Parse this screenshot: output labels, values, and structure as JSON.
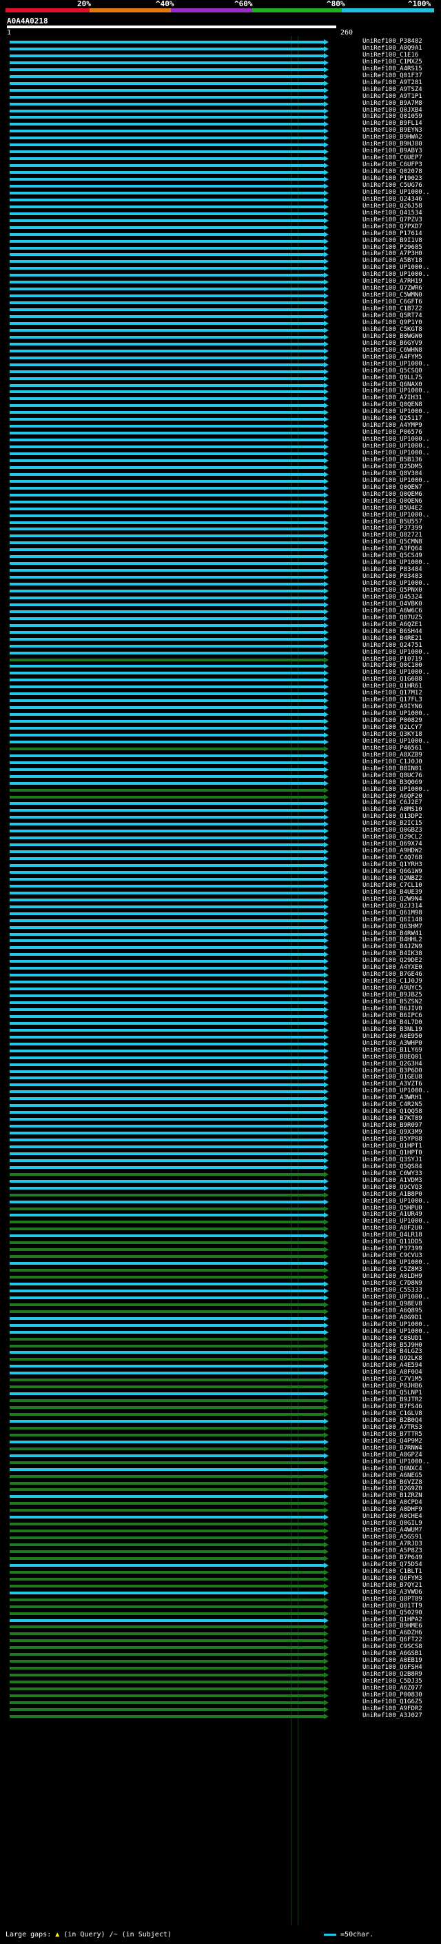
{
  "legend": {
    "ticks": [
      "20%",
      "^40%",
      "^60%",
      "^80%",
      "^100%"
    ],
    "colors": [
      "#e0102a",
      "#e07a10",
      "#9a2cc8",
      "#22b022",
      "#22c0e0"
    ]
  },
  "query": {
    "name": "A0A4A0218",
    "start_label": "1",
    "end_label": "260"
  },
  "footer": {
    "large_gaps_label": "Large gaps:",
    "gap_in_query": "(in Query)",
    "gap_in_subject": "/~ (in Subject)",
    "scale_label": "=50char."
  },
  "colors": {
    "cyan": "#22c8e8",
    "green": "#1e7a1e",
    "bright_green": "#3cd23c",
    "grey": "#7a8a8a"
  },
  "hits": [
    {
      "label": "UniRef100_P38482",
      "color": "cyan"
    },
    {
      "label": "UniRef100_A0Q9A1",
      "color": "cyan"
    },
    {
      "label": "UniRef100_C1E16",
      "color": "cyan"
    },
    {
      "label": "UniRef100_C1MXZ5",
      "color": "cyan"
    },
    {
      "label": "UniRef100_A4RS15",
      "color": "cyan"
    },
    {
      "label": "UniRef100_Q01F37",
      "color": "cyan"
    },
    {
      "label": "UniRef100_A9T281",
      "color": "cyan"
    },
    {
      "label": "UniRef100_A9TSZ4",
      "color": "cyan"
    },
    {
      "label": "UniRef100_A9T1P1",
      "color": "cyan"
    },
    {
      "label": "UniRef100_B9A7M8",
      "color": "cyan"
    },
    {
      "label": "UniRef100_Q0JXB4",
      "color": "cyan"
    },
    {
      "label": "UniRef100_Q01059",
      "color": "cyan"
    },
    {
      "label": "UniRef100_B9FL14",
      "color": "cyan"
    },
    {
      "label": "UniRef100_B9EYN3",
      "color": "cyan"
    },
    {
      "label": "UniRef100_B9HWA2",
      "color": "cyan"
    },
    {
      "label": "UniRef100_B9HJ80",
      "color": "cyan"
    },
    {
      "label": "UniRef100_B9ABY3",
      "color": "cyan"
    },
    {
      "label": "UniRef100_C6UEP7",
      "color": "cyan"
    },
    {
      "label": "UniRef100_C6UFP3",
      "color": "cyan"
    },
    {
      "label": "UniRef100_Q02078",
      "color": "cyan"
    },
    {
      "label": "UniRef100_P19023",
      "color": "cyan"
    },
    {
      "label": "UniRef100_C5UG76",
      "color": "cyan"
    },
    {
      "label": "UniRef100_UP1000..",
      "color": "cyan"
    },
    {
      "label": "UniRef100_Q24346",
      "color": "cyan"
    },
    {
      "label": "UniRef100_Q26J58",
      "color": "cyan"
    },
    {
      "label": "UniRef100_Q41534",
      "color": "cyan"
    },
    {
      "label": "UniRef100_Q7PZV3",
      "color": "cyan"
    },
    {
      "label": "UniRef100_Q7PXD7",
      "color": "cyan"
    },
    {
      "label": "UniRef100_P17614",
      "color": "cyan"
    },
    {
      "label": "UniRef100_B9I1V8",
      "color": "cyan"
    },
    {
      "label": "UniRef100_P29685",
      "color": "cyan"
    },
    {
      "label": "UniRef100_A7P3H0",
      "color": "cyan"
    },
    {
      "label": "UniRef100_A5BY18",
      "color": "cyan"
    },
    {
      "label": "UniRef100_UP1000..",
      "color": "cyan"
    },
    {
      "label": "UniRef100_UP1000..",
      "color": "cyan"
    },
    {
      "label": "UniRef100_A7RH19",
      "color": "cyan"
    },
    {
      "label": "UniRef100_Q7ZWR6",
      "color": "cyan"
    },
    {
      "label": "UniRef100_C5WMN0",
      "color": "cyan"
    },
    {
      "label": "UniRef100_C6GFT6",
      "color": "cyan"
    },
    {
      "label": "UniRef100_C1B7Z2",
      "color": "cyan"
    },
    {
      "label": "UniRef100_Q5RT74",
      "color": "cyan"
    },
    {
      "label": "UniRef100_Q9P1Y0",
      "color": "cyan"
    },
    {
      "label": "UniRef100_C5KGT8",
      "color": "cyan"
    },
    {
      "label": "UniRef100_B0WGW0",
      "color": "cyan"
    },
    {
      "label": "UniRef100_B6GYV9",
      "color": "cyan"
    },
    {
      "label": "UniRef100_C6WHN8",
      "color": "cyan"
    },
    {
      "label": "UniRef100_A4FYM5",
      "color": "cyan"
    },
    {
      "label": "UniRef100_UP1000..",
      "color": "cyan"
    },
    {
      "label": "UniRef100_Q5CSQ0",
      "color": "cyan"
    },
    {
      "label": "UniRef100_Q9LL75",
      "color": "cyan"
    },
    {
      "label": "UniRef100_Q6NAX0",
      "color": "cyan"
    },
    {
      "label": "UniRef100_UP1000..",
      "color": "cyan"
    },
    {
      "label": "UniRef100_A7IH31",
      "color": "cyan"
    },
    {
      "label": "UniRef100_Q0QEN8",
      "color": "cyan"
    },
    {
      "label": "UniRef100_UP1000..",
      "color": "cyan"
    },
    {
      "label": "UniRef100_Q25117",
      "color": "cyan"
    },
    {
      "label": "UniRef100_A4YMP9",
      "color": "cyan"
    },
    {
      "label": "UniRef100_P06576",
      "color": "cyan"
    },
    {
      "label": "UniRef100_UP1000..",
      "color": "cyan"
    },
    {
      "label": "UniRef100_UP1000..",
      "color": "cyan"
    },
    {
      "label": "UniRef100_UP1000..",
      "color": "cyan"
    },
    {
      "label": "UniRef100_B5B136",
      "color": "cyan"
    },
    {
      "label": "UniRef100_Q25DM5",
      "color": "cyan"
    },
    {
      "label": "UniRef100_Q8V304",
      "color": "cyan"
    },
    {
      "label": "UniRef100_UP1000..",
      "color": "cyan"
    },
    {
      "label": "UniRef100_Q0QEN7",
      "color": "cyan"
    },
    {
      "label": "UniRef100_Q0QEM6",
      "color": "cyan"
    },
    {
      "label": "UniRef100_Q0QEN6",
      "color": "cyan"
    },
    {
      "label": "UniRef100_B5U4E2",
      "color": "cyan"
    },
    {
      "label": "UniRef100_UP1000..",
      "color": "cyan"
    },
    {
      "label": "UniRef100_B5U557",
      "color": "cyan"
    },
    {
      "label": "UniRef100_P37399",
      "color": "cyan"
    },
    {
      "label": "UniRef100_Q82721",
      "color": "cyan"
    },
    {
      "label": "UniRef100_Q5CMN8",
      "color": "cyan"
    },
    {
      "label": "UniRef100_A3FQ64",
      "color": "cyan"
    },
    {
      "label": "UniRef100_Q5CS49",
      "color": "cyan"
    },
    {
      "label": "UniRef100_UP1000..",
      "color": "cyan"
    },
    {
      "label": "UniRef100_P83484",
      "color": "cyan"
    },
    {
      "label": "UniRef100_P83483",
      "color": "cyan"
    },
    {
      "label": "UniRef100_UP1000..",
      "color": "cyan"
    },
    {
      "label": "UniRef100_Q5PNX0",
      "color": "cyan"
    },
    {
      "label": "UniRef100_Q45324",
      "color": "cyan"
    },
    {
      "label": "UniRef100_Q4VBK0",
      "color": "cyan"
    },
    {
      "label": "UniRef100_A6W6C6",
      "color": "cyan"
    },
    {
      "label": "UniRef100_Q07UZ5",
      "color": "cyan"
    },
    {
      "label": "UniRef100_A6QZE1",
      "color": "cyan"
    },
    {
      "label": "UniRef100_B6SH44",
      "color": "cyan"
    },
    {
      "label": "UniRef100_B4RE21",
      "color": "cyan"
    },
    {
      "label": "UniRef100_Q24751",
      "color": "cyan"
    },
    {
      "label": "UniRef100_UP1000..",
      "color": "cyan"
    },
    {
      "label": "UniRef100_P10719",
      "color": "green"
    },
    {
      "label": "UniRef100_Q0C100",
      "color": "cyan"
    },
    {
      "label": "UniRef100_UP1000..",
      "color": "cyan"
    },
    {
      "label": "UniRef100_Q1G6B8",
      "color": "cyan"
    },
    {
      "label": "UniRef100_Q1HR61",
      "color": "cyan"
    },
    {
      "label": "UniRef100_Q17M12",
      "color": "cyan"
    },
    {
      "label": "UniRef100_Q17FL3",
      "color": "cyan"
    },
    {
      "label": "UniRef100_A9IYN6",
      "color": "cyan"
    },
    {
      "label": "UniRef100_UP1000..",
      "color": "cyan"
    },
    {
      "label": "UniRef100_P00829",
      "color": "cyan"
    },
    {
      "label": "UniRef100_Q2LCY7",
      "color": "cyan"
    },
    {
      "label": "UniRef100_Q3KY18",
      "color": "cyan"
    },
    {
      "label": "UniRef100_UP1000..",
      "color": "cyan"
    },
    {
      "label": "UniRef100_P46561",
      "color": "green"
    },
    {
      "label": "UniRef100_A8XZB9",
      "color": "cyan"
    },
    {
      "label": "UniRef100_C1J0J0",
      "color": "cyan"
    },
    {
      "label": "UniRef100_B8IN01",
      "color": "cyan"
    },
    {
      "label": "UniRef100_Q8UC76",
      "color": "cyan"
    },
    {
      "label": "UniRef100_B3Q069",
      "color": "cyan"
    },
    {
      "label": "UniRef100_UP1000..",
      "color": "green"
    },
    {
      "label": "UniRef100_A6QF20",
      "color": "green"
    },
    {
      "label": "UniRef100_C6J2E7",
      "color": "cyan"
    },
    {
      "label": "UniRef100_A8MS10",
      "color": "cyan"
    },
    {
      "label": "UniRef100_Q13DP2",
      "color": "cyan"
    },
    {
      "label": "UniRef100_B2IC15",
      "color": "cyan"
    },
    {
      "label": "UniRef100_Q0GBZ3",
      "color": "cyan"
    },
    {
      "label": "UniRef100_Q29CL2",
      "color": "cyan"
    },
    {
      "label": "UniRef100_Q69X74",
      "color": "cyan"
    },
    {
      "label": "UniRef100_A9HDW2",
      "color": "cyan"
    },
    {
      "label": "UniRef100_C4Q768",
      "color": "cyan"
    },
    {
      "label": "UniRef100_Q1YRH3",
      "color": "cyan"
    },
    {
      "label": "UniRef100_Q6G1W9",
      "color": "cyan"
    },
    {
      "label": "UniRef100_Q2NBZ2",
      "color": "cyan"
    },
    {
      "label": "UniRef100_C7CL10",
      "color": "cyan"
    },
    {
      "label": "UniRef100_B4UE39",
      "color": "cyan"
    },
    {
      "label": "UniRef100_Q2W9N4",
      "color": "cyan"
    },
    {
      "label": "UniRef100_Q2J314",
      "color": "cyan"
    },
    {
      "label": "UniRef100_Q61M98",
      "color": "cyan"
    },
    {
      "label": "UniRef100_Q6I148",
      "color": "cyan"
    },
    {
      "label": "UniRef100_Q63HM7",
      "color": "cyan"
    },
    {
      "label": "UniRef100_B4RW41",
      "color": "cyan"
    },
    {
      "label": "UniRef100_B4HHL2",
      "color": "cyan"
    },
    {
      "label": "UniRef100_B4JZN9",
      "color": "cyan"
    },
    {
      "label": "UniRef100_B4IK38",
      "color": "cyan"
    },
    {
      "label": "UniRef100_Q29DE2",
      "color": "cyan"
    },
    {
      "label": "UniRef100_A4YXE0",
      "color": "cyan"
    },
    {
      "label": "UniRef100_B7GE46",
      "color": "cyan"
    },
    {
      "label": "UniRef100_C1J0J9",
      "color": "cyan"
    },
    {
      "label": "UniRef100_A9UYC5",
      "color": "cyan"
    },
    {
      "label": "UniRef100_B9JBZ5",
      "color": "cyan"
    },
    {
      "label": "UniRef100_B5ZSN2",
      "color": "cyan"
    },
    {
      "label": "UniRef100_B6JIV0",
      "color": "cyan"
    },
    {
      "label": "UniRef100_B6IPC6",
      "color": "cyan"
    },
    {
      "label": "UniRef100_B4L7D0",
      "color": "cyan"
    },
    {
      "label": "UniRef100_B3NL19",
      "color": "cyan"
    },
    {
      "label": "UniRef100_A0E950",
      "color": "cyan"
    },
    {
      "label": "UniRef100_A3WHP0",
      "color": "cyan"
    },
    {
      "label": "UniRef100_B1LY69",
      "color": "cyan"
    },
    {
      "label": "UniRef100_B8EQ01",
      "color": "cyan"
    },
    {
      "label": "UniRef100_Q2G3H4",
      "color": "cyan"
    },
    {
      "label": "UniRef100_B3P6D0",
      "color": "cyan"
    },
    {
      "label": "UniRef100_Q1GEU8",
      "color": "cyan"
    },
    {
      "label": "UniRef100_A3VZT6",
      "color": "cyan"
    },
    {
      "label": "UniRef100_UP1000..",
      "color": "cyan"
    },
    {
      "label": "UniRef100_A3WRH1",
      "color": "cyan"
    },
    {
      "label": "UniRef100_C4R2N5",
      "color": "cyan"
    },
    {
      "label": "UniRef100_Q1QQ58",
      "color": "cyan"
    },
    {
      "label": "UniRef100_B7KT89",
      "color": "cyan"
    },
    {
      "label": "UniRef100_B9R097",
      "color": "cyan"
    },
    {
      "label": "UniRef100_Q9X3M9",
      "color": "cyan"
    },
    {
      "label": "UniRef100_B5YP88",
      "color": "cyan"
    },
    {
      "label": "UniRef100_Q1HPT1",
      "color": "cyan"
    },
    {
      "label": "UniRef100_Q1HPT0",
      "color": "cyan"
    },
    {
      "label": "UniRef100_Q3SYJ1",
      "color": "cyan"
    },
    {
      "label": "UniRef100_Q5QS84",
      "color": "cyan"
    },
    {
      "label": "UniRef100_C6WY33",
      "color": "green"
    },
    {
      "label": "UniRef100_A1VDM3",
      "color": "cyan"
    },
    {
      "label": "UniRef100_Q9CVQ3",
      "color": "cyan"
    },
    {
      "label": "UniRef100_A1B8P0",
      "color": "green"
    },
    {
      "label": "UniRef100_UP1000..",
      "color": "cyan"
    },
    {
      "label": "UniRef100_Q5HPU0",
      "color": "green"
    },
    {
      "label": "UniRef100_A1UR49",
      "color": "cyan"
    },
    {
      "label": "UniRef100_UP1000..",
      "color": "green"
    },
    {
      "label": "UniRef100_A8F2U0",
      "color": "green"
    },
    {
      "label": "UniRef100_Q4LR18",
      "color": "cyan"
    },
    {
      "label": "UniRef100_Q11DD5",
      "color": "green"
    },
    {
      "label": "UniRef100_P37399",
      "color": "green"
    },
    {
      "label": "UniRef100_C9CVU3",
      "color": "green"
    },
    {
      "label": "UniRef100_UP1000..",
      "color": "cyan"
    },
    {
      "label": "UniRef100_C5Z8M3",
      "color": "green"
    },
    {
      "label": "UniRef100_A0LDH9",
      "color": "green"
    },
    {
      "label": "UniRef100_C7D8N9",
      "color": "cyan"
    },
    {
      "label": "UniRef100_C5S333",
      "color": "cyan"
    },
    {
      "label": "UniRef100_UP1000..",
      "color": "cyan"
    },
    {
      "label": "UniRef100_Q98EV8",
      "color": "green"
    },
    {
      "label": "UniRef100_A6Q895",
      "color": "green"
    },
    {
      "label": "UniRef100_A8G9D1",
      "color": "cyan"
    },
    {
      "label": "UniRef100_UP1000..",
      "color": "cyan"
    },
    {
      "label": "UniRef100_UP1000..",
      "color": "cyan"
    },
    {
      "label": "UniRef100_C8SUD1",
      "color": "green"
    },
    {
      "label": "UniRef100_B5J9H0",
      "color": "green"
    },
    {
      "label": "UniRef100_B4LGZ3",
      "color": "cyan"
    },
    {
      "label": "UniRef100_Q92LK8",
      "color": "green"
    },
    {
      "label": "UniRef100_A4E594",
      "color": "cyan"
    },
    {
      "label": "UniRef100_A8F0O4",
      "color": "cyan"
    },
    {
      "label": "UniRef100_C7V1M5",
      "color": "green"
    },
    {
      "label": "UniRef100_P0JHB6",
      "color": "green"
    },
    {
      "label": "UniRef100_Q5LNP1",
      "color": "cyan"
    },
    {
      "label": "UniRef100_B9JTR2",
      "color": "green"
    },
    {
      "label": "UniRef100_B7FS46",
      "color": "green"
    },
    {
      "label": "UniRef100_C1GLV8",
      "color": "green"
    },
    {
      "label": "UniRef100_B2B0Q4",
      "color": "cyan"
    },
    {
      "label": "UniRef100_A7TRS3",
      "color": "green"
    },
    {
      "label": "UniRef100_B7TTR5",
      "color": "green"
    },
    {
      "label": "UniRef100_Q4P9M2",
      "color": "cyan"
    },
    {
      "label": "UniRef100_B7RNW4",
      "color": "green"
    },
    {
      "label": "UniRef100_A8GPZ4",
      "color": "cyan"
    },
    {
      "label": "UniRef100_UP1000..",
      "color": "green"
    },
    {
      "label": "UniRef100_Q6NXC4",
      "color": "cyan"
    },
    {
      "label": "UniRef100_A6NEG5",
      "color": "green"
    },
    {
      "label": "UniRef100_B6VZZ8",
      "color": "green"
    },
    {
      "label": "UniRef100_Q2G9Z0",
      "color": "green"
    },
    {
      "label": "UniRef100_B1ZRZN",
      "color": "cyan"
    },
    {
      "label": "UniRef100_A0CPD4",
      "color": "green"
    },
    {
      "label": "UniRef100_A0DHF9",
      "color": "green"
    },
    {
      "label": "UniRef100_A0CHE4",
      "color": "cyan"
    },
    {
      "label": "UniRef100_Q0GIL9",
      "color": "green"
    },
    {
      "label": "UniRef100_A4WUM7",
      "color": "green"
    },
    {
      "label": "UniRef100_A5GS91",
      "color": "green"
    },
    {
      "label": "UniRef100_A7RJD3",
      "color": "green"
    },
    {
      "label": "UniRef100_A5P8Z3",
      "color": "green"
    },
    {
      "label": "UniRef100_B7P649",
      "color": "green"
    },
    {
      "label": "UniRef100_Q75D54",
      "color": "cyan"
    },
    {
      "label": "UniRef100_C1BLT1",
      "color": "green"
    },
    {
      "label": "UniRef100_Q6FYM3",
      "color": "green"
    },
    {
      "label": "UniRef100_B7QY21",
      "color": "green"
    },
    {
      "label": "UniRef100_A3VWD6",
      "color": "cyan"
    },
    {
      "label": "UniRef100_Q8PT89",
      "color": "green"
    },
    {
      "label": "UniRef100_Q01TT9",
      "color": "green"
    },
    {
      "label": "UniRef100_Q50290",
      "color": "green"
    },
    {
      "label": "UniRef100_Q1HPA2",
      "color": "cyan"
    },
    {
      "label": "UniRef100_B9HME6",
      "color": "green"
    },
    {
      "label": "UniRef100_A6DZH6",
      "color": "green"
    },
    {
      "label": "UniRef100_Q6FT22",
      "color": "green"
    },
    {
      "label": "UniRef100_C9SCS8",
      "color": "green"
    },
    {
      "label": "UniRef100_A6GSB1",
      "color": "green"
    },
    {
      "label": "UniRef100_A0EB19",
      "color": "green"
    },
    {
      "label": "UniRef100_Q6FSH4",
      "color": "green"
    },
    {
      "label": "UniRef100_Q2B8R9",
      "color": "green"
    },
    {
      "label": "UniRef100_C5DJ35",
      "color": "green"
    },
    {
      "label": "UniRef100_A6Z077",
      "color": "green"
    },
    {
      "label": "UniRef100_P00830",
      "color": "green"
    },
    {
      "label": "UniRef100_Q1G6Z5",
      "color": "green"
    },
    {
      "label": "UniRef100_A9FDR2",
      "color": "green"
    },
    {
      "label": "UniRef100_A3J027",
      "color": "green"
    }
  ]
}
